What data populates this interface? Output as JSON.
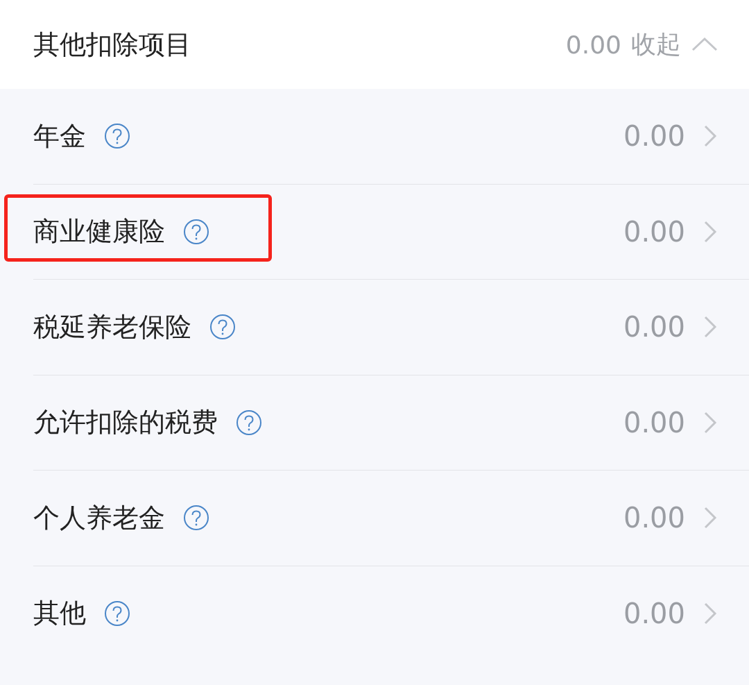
{
  "header": {
    "title": "其他扣除项目",
    "total": "0.00",
    "toggle": "收起",
    "expanded": true
  },
  "items": [
    {
      "label": "年金",
      "value": "0.00",
      "highlighted": false
    },
    {
      "label": "商业健康险",
      "value": "0.00",
      "highlighted": true
    },
    {
      "label": "税延养老保险",
      "value": "0.00",
      "highlighted": false
    },
    {
      "label": "允许扣除的税费",
      "value": "0.00",
      "highlighted": false
    },
    {
      "label": "个人养老金",
      "value": "0.00",
      "highlighted": false
    },
    {
      "label": "其他",
      "value": "0.00",
      "highlighted": false
    }
  ]
}
